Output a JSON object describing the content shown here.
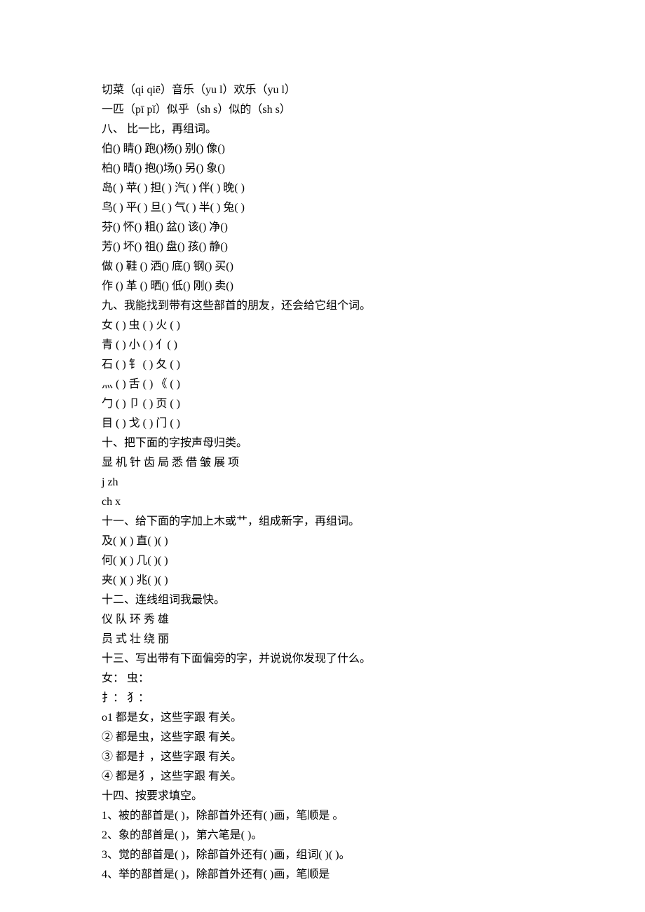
{
  "lines": [
    "切菜（qi qiē）音乐（yu l）欢乐（yu l）",
    "一匹（pī pǐ）似乎（sh s）似的（sh s）",
    "八、 比一比，再组词。",
    "伯() 睛() 跑()杨() 别() 像()",
    "柏() 晴() 抱()场() 另() 象()",
    "岛( ) 苹( ) 担( ) 汽( ) 伴( ) 晚( )",
    "鸟( ) 平( ) 旦( ) 气( ) 半( ) 兔( )",
    "芬() 怀() 粗() 盆() 该() 净()",
    "芳() 坏() 祖() 盘() 孩() 静()",
    "做 () 鞋 () 洒() 底() 钢() 买()",
    "作 () 革 () 晒() 低() 刚() 卖()",
    "九、我能找到带有这些部首的朋友，还会给它组个词。",
    "女 ( ) 虫 ( ) 火 ( )",
    "青 ( ) 小 ( ) 亻( )",
    "石 ( ) 钅 ( ) 夂 ( )",
    "灬 ( ) 舌 ( ) 《 ( )",
    "勹 ( ) 卩 ( ) 页 ( )",
    "目 ( ) 戈 ( ) 门 ( )",
    "十、把下面的字按声母归类。",
    "显 机 针 齿 局 悉 借 皱 展 项",
    "j zh",
    "ch x",
    "十一、给下面的字加上木或艹，组成新字，再组词。",
    "及( )( ) 直( )( )",
    "何( )( ) 几( )( )",
    "夹( )( ) 兆( )( )",
    "十二、连线组词我最快。",
    "仪 队 环 秀 雄",
    "员 式 壮 绕 丽",
    "十三、写出带有下面偏旁的字，并说说你发现了什么。",
    "女： 虫：",
    "扌： 犭：",
    "o1 都是女，这些字跟 有关。",
    "② 都是虫，这些字跟 有关。",
    "③ 都是扌，这些字跟 有关。",
    "④ 都是犭，这些字跟 有关。",
    "十四、按要求填空。",
    "1、被的部首是( )，除部首外还有( )画，笔顺是 。",
    "2、象的部首是( )，第六笔是( )。",
    "3、觉的部首是( )，除部首外还有( )画，组词( )( )。",
    "4、举的部首是( )，除部首外还有( )画，笔顺是"
  ]
}
